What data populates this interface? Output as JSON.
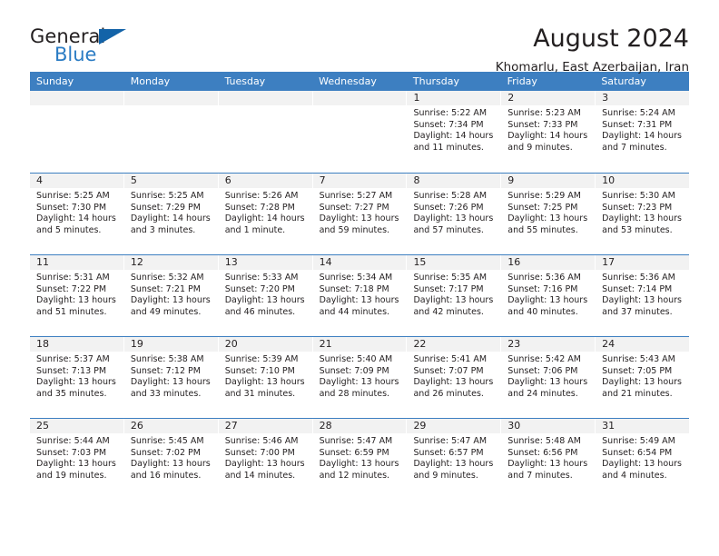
{
  "brand": {
    "name_top": "General",
    "name_bottom": "Blue",
    "triangle_color": "#1363a8",
    "blue_text_color": "#2b7cc4"
  },
  "header": {
    "title": "August 2024",
    "subtitle": "Khomarlu, East Azerbaijan, Iran"
  },
  "theme": {
    "header_blue": "#3d7fc1",
    "day_band_gray": "#f2f2f2",
    "text_color": "#231f20"
  },
  "calendar": {
    "weekdays": [
      "Sunday",
      "Monday",
      "Tuesday",
      "Wednesday",
      "Thursday",
      "Friday",
      "Saturday"
    ],
    "weeks": [
      [
        {
          "day": "",
          "sunrise": "",
          "sunset": "",
          "daylight_1": "",
          "daylight_2": ""
        },
        {
          "day": "",
          "sunrise": "",
          "sunset": "",
          "daylight_1": "",
          "daylight_2": ""
        },
        {
          "day": "",
          "sunrise": "",
          "sunset": "",
          "daylight_1": "",
          "daylight_2": ""
        },
        {
          "day": "",
          "sunrise": "",
          "sunset": "",
          "daylight_1": "",
          "daylight_2": ""
        },
        {
          "day": "1",
          "sunrise": "Sunrise: 5:22 AM",
          "sunset": "Sunset: 7:34 PM",
          "daylight_1": "Daylight: 14 hours",
          "daylight_2": "and 11 minutes."
        },
        {
          "day": "2",
          "sunrise": "Sunrise: 5:23 AM",
          "sunset": "Sunset: 7:33 PM",
          "daylight_1": "Daylight: 14 hours",
          "daylight_2": "and 9 minutes."
        },
        {
          "day": "3",
          "sunrise": "Sunrise: 5:24 AM",
          "sunset": "Sunset: 7:31 PM",
          "daylight_1": "Daylight: 14 hours",
          "daylight_2": "and 7 minutes."
        }
      ],
      [
        {
          "day": "4",
          "sunrise": "Sunrise: 5:25 AM",
          "sunset": "Sunset: 7:30 PM",
          "daylight_1": "Daylight: 14 hours",
          "daylight_2": "and 5 minutes."
        },
        {
          "day": "5",
          "sunrise": "Sunrise: 5:25 AM",
          "sunset": "Sunset: 7:29 PM",
          "daylight_1": "Daylight: 14 hours",
          "daylight_2": "and 3 minutes."
        },
        {
          "day": "6",
          "sunrise": "Sunrise: 5:26 AM",
          "sunset": "Sunset: 7:28 PM",
          "daylight_1": "Daylight: 14 hours",
          "daylight_2": "and 1 minute."
        },
        {
          "day": "7",
          "sunrise": "Sunrise: 5:27 AM",
          "sunset": "Sunset: 7:27 PM",
          "daylight_1": "Daylight: 13 hours",
          "daylight_2": "and 59 minutes."
        },
        {
          "day": "8",
          "sunrise": "Sunrise: 5:28 AM",
          "sunset": "Sunset: 7:26 PM",
          "daylight_1": "Daylight: 13 hours",
          "daylight_2": "and 57 minutes."
        },
        {
          "day": "9",
          "sunrise": "Sunrise: 5:29 AM",
          "sunset": "Sunset: 7:25 PM",
          "daylight_1": "Daylight: 13 hours",
          "daylight_2": "and 55 minutes."
        },
        {
          "day": "10",
          "sunrise": "Sunrise: 5:30 AM",
          "sunset": "Sunset: 7:23 PM",
          "daylight_1": "Daylight: 13 hours",
          "daylight_2": "and 53 minutes."
        }
      ],
      [
        {
          "day": "11",
          "sunrise": "Sunrise: 5:31 AM",
          "sunset": "Sunset: 7:22 PM",
          "daylight_1": "Daylight: 13 hours",
          "daylight_2": "and 51 minutes."
        },
        {
          "day": "12",
          "sunrise": "Sunrise: 5:32 AM",
          "sunset": "Sunset: 7:21 PM",
          "daylight_1": "Daylight: 13 hours",
          "daylight_2": "and 49 minutes."
        },
        {
          "day": "13",
          "sunrise": "Sunrise: 5:33 AM",
          "sunset": "Sunset: 7:20 PM",
          "daylight_1": "Daylight: 13 hours",
          "daylight_2": "and 46 minutes."
        },
        {
          "day": "14",
          "sunrise": "Sunrise: 5:34 AM",
          "sunset": "Sunset: 7:18 PM",
          "daylight_1": "Daylight: 13 hours",
          "daylight_2": "and 44 minutes."
        },
        {
          "day": "15",
          "sunrise": "Sunrise: 5:35 AM",
          "sunset": "Sunset: 7:17 PM",
          "daylight_1": "Daylight: 13 hours",
          "daylight_2": "and 42 minutes."
        },
        {
          "day": "16",
          "sunrise": "Sunrise: 5:36 AM",
          "sunset": "Sunset: 7:16 PM",
          "daylight_1": "Daylight: 13 hours",
          "daylight_2": "and 40 minutes."
        },
        {
          "day": "17",
          "sunrise": "Sunrise: 5:36 AM",
          "sunset": "Sunset: 7:14 PM",
          "daylight_1": "Daylight: 13 hours",
          "daylight_2": "and 37 minutes."
        }
      ],
      [
        {
          "day": "18",
          "sunrise": "Sunrise: 5:37 AM",
          "sunset": "Sunset: 7:13 PM",
          "daylight_1": "Daylight: 13 hours",
          "daylight_2": "and 35 minutes."
        },
        {
          "day": "19",
          "sunrise": "Sunrise: 5:38 AM",
          "sunset": "Sunset: 7:12 PM",
          "daylight_1": "Daylight: 13 hours",
          "daylight_2": "and 33 minutes."
        },
        {
          "day": "20",
          "sunrise": "Sunrise: 5:39 AM",
          "sunset": "Sunset: 7:10 PM",
          "daylight_1": "Daylight: 13 hours",
          "daylight_2": "and 31 minutes."
        },
        {
          "day": "21",
          "sunrise": "Sunrise: 5:40 AM",
          "sunset": "Sunset: 7:09 PM",
          "daylight_1": "Daylight: 13 hours",
          "daylight_2": "and 28 minutes."
        },
        {
          "day": "22",
          "sunrise": "Sunrise: 5:41 AM",
          "sunset": "Sunset: 7:07 PM",
          "daylight_1": "Daylight: 13 hours",
          "daylight_2": "and 26 minutes."
        },
        {
          "day": "23",
          "sunrise": "Sunrise: 5:42 AM",
          "sunset": "Sunset: 7:06 PM",
          "daylight_1": "Daylight: 13 hours",
          "daylight_2": "and 24 minutes."
        },
        {
          "day": "24",
          "sunrise": "Sunrise: 5:43 AM",
          "sunset": "Sunset: 7:05 PM",
          "daylight_1": "Daylight: 13 hours",
          "daylight_2": "and 21 minutes."
        }
      ],
      [
        {
          "day": "25",
          "sunrise": "Sunrise: 5:44 AM",
          "sunset": "Sunset: 7:03 PM",
          "daylight_1": "Daylight: 13 hours",
          "daylight_2": "and 19 minutes."
        },
        {
          "day": "26",
          "sunrise": "Sunrise: 5:45 AM",
          "sunset": "Sunset: 7:02 PM",
          "daylight_1": "Daylight: 13 hours",
          "daylight_2": "and 16 minutes."
        },
        {
          "day": "27",
          "sunrise": "Sunrise: 5:46 AM",
          "sunset": "Sunset: 7:00 PM",
          "daylight_1": "Daylight: 13 hours",
          "daylight_2": "and 14 minutes."
        },
        {
          "day": "28",
          "sunrise": "Sunrise: 5:47 AM",
          "sunset": "Sunset: 6:59 PM",
          "daylight_1": "Daylight: 13 hours",
          "daylight_2": "and 12 minutes."
        },
        {
          "day": "29",
          "sunrise": "Sunrise: 5:47 AM",
          "sunset": "Sunset: 6:57 PM",
          "daylight_1": "Daylight: 13 hours",
          "daylight_2": "and 9 minutes."
        },
        {
          "day": "30",
          "sunrise": "Sunrise: 5:48 AM",
          "sunset": "Sunset: 6:56 PM",
          "daylight_1": "Daylight: 13 hours",
          "daylight_2": "and 7 minutes."
        },
        {
          "day": "31",
          "sunrise": "Sunrise: 5:49 AM",
          "sunset": "Sunset: 6:54 PM",
          "daylight_1": "Daylight: 13 hours",
          "daylight_2": "and 4 minutes."
        }
      ]
    ]
  }
}
